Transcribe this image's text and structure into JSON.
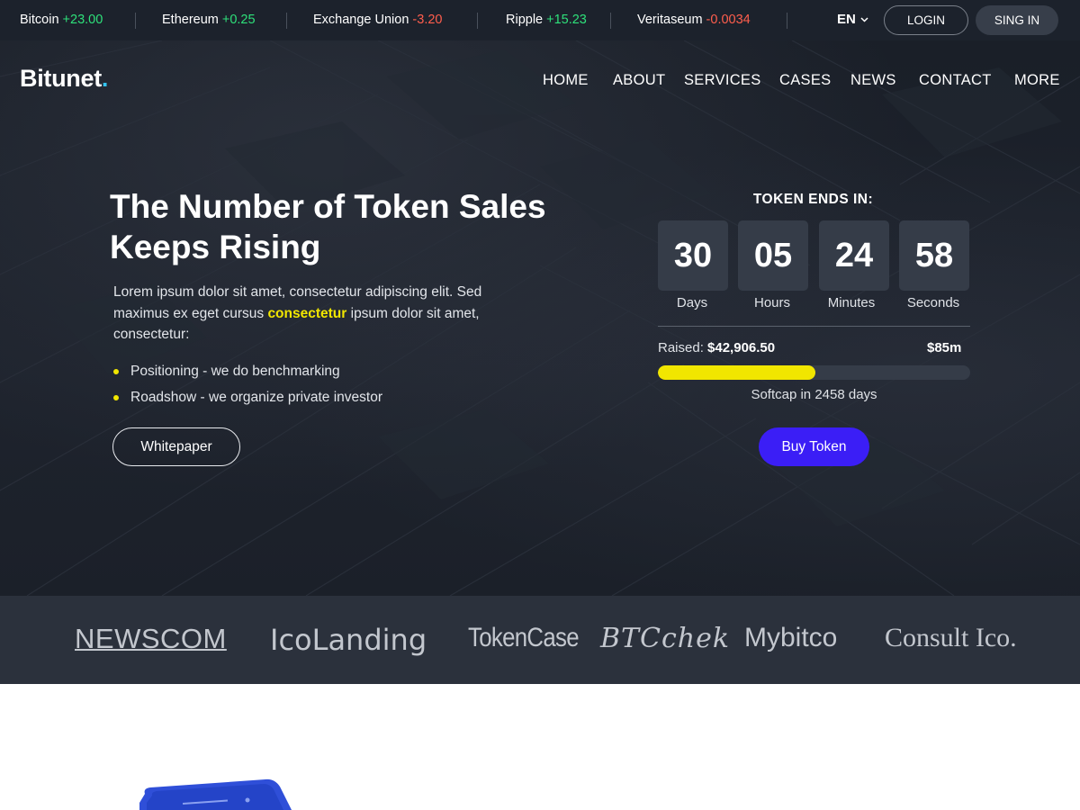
{
  "ticker": {
    "items": [
      {
        "name": "Bitcoin",
        "change": "+23.00"
      },
      {
        "name": "Ethereum",
        "change": "+0.25"
      },
      {
        "name": "Exchange Union",
        "change": "-3.20"
      },
      {
        "name": "Ripple",
        "change": "+15.23"
      },
      {
        "name": "Veritaseum",
        "change": "-0.0034"
      }
    ],
    "language": "EN",
    "login_label": "LOGIN",
    "signin_label": "SING IN"
  },
  "brand": {
    "name": "Bitunet",
    "dot": "."
  },
  "nav": {
    "items": [
      "HOME",
      "ABOUT",
      "SERVICES",
      "CASES",
      "NEWS",
      "CONTACT",
      "MORE"
    ]
  },
  "hero": {
    "headline": "The Number of Token Sales Keeps Rising",
    "lead_1": "Lorem ipsum dolor sit amet, consectetur adipiscing elit. Sed maximus ex eget cursus ",
    "lead_highlight": "consectetur",
    "lead_2": " ipsum dolor sit amet, consectetur:",
    "bullets": [
      "Positioning - we do benchmarking",
      "Roadshow - we organize private investor"
    ],
    "whitepaper_label": "Whitepaper"
  },
  "countdown": {
    "title": "TOKEN ENDS IN:",
    "units": [
      {
        "value": "30",
        "label": "Days"
      },
      {
        "value": "05",
        "label": "Hours"
      },
      {
        "value": "24",
        "label": "Minutes"
      },
      {
        "value": "58",
        "label": "Seconds"
      }
    ],
    "raised_label": "Raised:",
    "raised_value": "$42,906.50",
    "goal": "$85m",
    "progress": 0.505,
    "softcap": "Softcap in 2458 days",
    "buy_label": "Buy Token"
  },
  "partners": [
    "NEWSCOM",
    "IcoLanding",
    "TokenCase",
    "BTCchek",
    "Mybitco",
    "Consult Ico."
  ],
  "colors": {
    "up": "#2ee07a",
    "down": "#ff5e4d",
    "highlight": "#f1e600",
    "accent": "#3b1ef6",
    "brand_dot": "#33c3f0"
  }
}
